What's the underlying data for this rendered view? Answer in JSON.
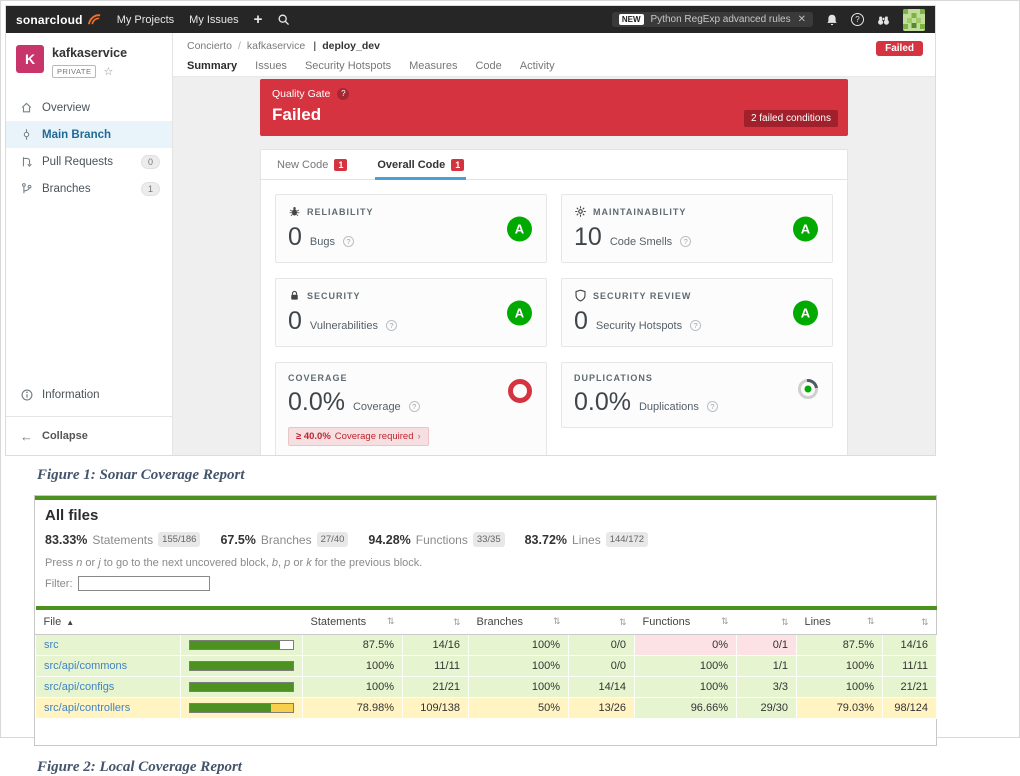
{
  "figure1": {
    "navbar": {
      "brand": "sonarcloud",
      "my_projects": "My Projects",
      "my_issues": "My Issues",
      "promo_badge": "NEW",
      "promo_text": "Python RegExp advanced rules"
    },
    "sidebar": {
      "project_initial": "K",
      "project_name": "kafkaservice",
      "visibility": "PRIVATE",
      "items": [
        {
          "label": "Overview"
        },
        {
          "label": "Main Branch"
        },
        {
          "label": "Pull Requests",
          "badge": "0"
        },
        {
          "label": "Branches",
          "badge": "1"
        }
      ],
      "information": "Information",
      "collapse": "Collapse"
    },
    "header": {
      "crumbs": [
        "Concierto",
        "kafkaservice"
      ],
      "sep": "/",
      "branch": "deploy_dev",
      "status_badge": "Failed",
      "tabs": [
        "Summary",
        "Issues",
        "Security Hotspots",
        "Measures",
        "Code",
        "Activity"
      ]
    },
    "quality_gate": {
      "label": "Quality Gate",
      "status": "Failed",
      "conditions_badge": "2 failed conditions"
    },
    "code_tabs": [
      {
        "label": "New Code",
        "badge": "1"
      },
      {
        "label": "Overall Code",
        "badge": "1"
      }
    ],
    "metrics": [
      {
        "category": "RELIABILITY",
        "value": "0",
        "label": "Bugs",
        "rating": "A"
      },
      {
        "category": "MAINTAINABILITY",
        "value": "10",
        "label": "Code Smells",
        "rating": "A"
      },
      {
        "category": "SECURITY",
        "value": "0",
        "label": "Vulnerabilities",
        "rating": "A"
      },
      {
        "category": "SECURITY REVIEW",
        "value": "0",
        "label": "Security Hotspots",
        "rating": "A"
      },
      {
        "category": "COVERAGE",
        "value": "0.0%",
        "label": "Coverage",
        "warning_strong": "≥ 40.0%",
        "warning_text": "Coverage required"
      },
      {
        "category": "DUPLICATIONS",
        "value": "0.0%",
        "label": "Duplications"
      }
    ],
    "colors": {
      "red": "#d4333f",
      "rating_green": "#00aa00",
      "tab_blue": "#4b9fd5"
    }
  },
  "captions": {
    "figure1": "Figure 1: Sonar Coverage Report",
    "figure2": "Figure 2: Local Coverage Report"
  },
  "figure2": {
    "title": "All files",
    "summary": [
      {
        "pct": "83.33%",
        "label": "Statements",
        "frac": "155/186"
      },
      {
        "pct": "67.5%",
        "label": "Branches",
        "frac": "27/40"
      },
      {
        "pct": "94.28%",
        "label": "Functions",
        "frac": "33/35"
      },
      {
        "pct": "83.72%",
        "label": "Lines",
        "frac": "144/172"
      }
    ],
    "hint": [
      "Press ",
      "n",
      " or ",
      "j",
      " to go to the next uncovered block, ",
      "b",
      ", ",
      "p",
      " or ",
      "k",
      " for the previous block."
    ],
    "filter_label": "Filter:",
    "headers": [
      "File",
      "Statements",
      "Branches",
      "Functions",
      "Lines"
    ],
    "theme_green": "#4d9221",
    "rows": [
      {
        "file": "src",
        "file_class": "high",
        "bar": 87.5,
        "bar_rest": "#ffffff",
        "cells": [
          {
            "t": "87.5%",
            "c": "high"
          },
          {
            "t": "14/16",
            "c": "high"
          },
          {
            "t": "100%",
            "c": "high"
          },
          {
            "t": "0/0",
            "c": "high"
          },
          {
            "t": "0%",
            "c": "low"
          },
          {
            "t": "0/1",
            "c": "low"
          },
          {
            "t": "87.5%",
            "c": "high"
          },
          {
            "t": "14/16",
            "c": "high"
          }
        ]
      },
      {
        "file": "src/api/commons",
        "file_class": "high",
        "bar": 100,
        "bar_rest": "#ffffff",
        "cells": [
          {
            "t": "100%",
            "c": "high"
          },
          {
            "t": "11/11",
            "c": "high"
          },
          {
            "t": "100%",
            "c": "high"
          },
          {
            "t": "0/0",
            "c": "high"
          },
          {
            "t": "100%",
            "c": "high"
          },
          {
            "t": "1/1",
            "c": "high"
          },
          {
            "t": "100%",
            "c": "high"
          },
          {
            "t": "11/11",
            "c": "high"
          }
        ]
      },
      {
        "file": "src/api/configs",
        "file_class": "high",
        "bar": 100,
        "bar_rest": "#ffffff",
        "cells": [
          {
            "t": "100%",
            "c": "high"
          },
          {
            "t": "21/21",
            "c": "high"
          },
          {
            "t": "100%",
            "c": "high"
          },
          {
            "t": "14/14",
            "c": "high"
          },
          {
            "t": "100%",
            "c": "high"
          },
          {
            "t": "3/3",
            "c": "high"
          },
          {
            "t": "100%",
            "c": "high"
          },
          {
            "t": "21/21",
            "c": "high"
          }
        ]
      },
      {
        "file": "src/api/controllers",
        "file_class": "medium",
        "bar": 78.98,
        "bar_rest": "#f7cf4d",
        "cells": [
          {
            "t": "78.98%",
            "c": "medium"
          },
          {
            "t": "109/138",
            "c": "medium"
          },
          {
            "t": "50%",
            "c": "medium"
          },
          {
            "t": "13/26",
            "c": "medium"
          },
          {
            "t": "96.66%",
            "c": "high"
          },
          {
            "t": "29/30",
            "c": "high"
          },
          {
            "t": "79.03%",
            "c": "medium"
          },
          {
            "t": "98/124",
            "c": "medium"
          }
        ]
      }
    ]
  }
}
